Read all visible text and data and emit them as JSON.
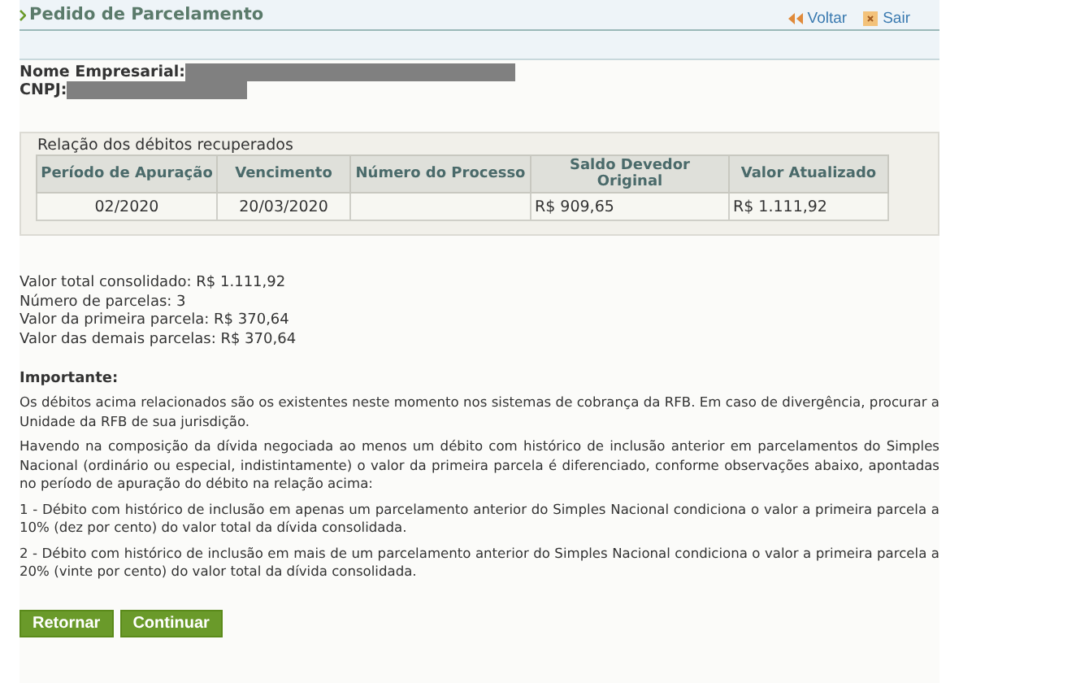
{
  "header": {
    "title": "Pedido de Parcelamento",
    "links": [
      {
        "kind": "back",
        "label": "Voltar"
      },
      {
        "kind": "exit",
        "label": "Sair"
      }
    ]
  },
  "company": {
    "name_label": "Nome Empresarial:",
    "cnpj_label": "CNPJ:"
  },
  "table": {
    "caption": "Relação dos débitos recuperados",
    "columns": [
      "Período de Apuração",
      "Vencimento",
      "Número do Processo",
      "Saldo Devedor Original",
      "Valor Atualizado"
    ],
    "rows": [
      [
        "02/2020",
        "20/03/2020",
        "",
        "R$ 909,65",
        "R$ 1.111,92"
      ]
    ]
  },
  "summary": [
    "Valor total consolidado: R$ 1.111,92",
    "Número de parcelas: 3",
    "Valor da primeira parcela: R$ 370,64",
    "Valor das demais parcelas: R$ 370,64"
  ],
  "notice": {
    "heading": "Importante:",
    "paragraphs": [
      "Os débitos acima relacionados são os existentes neste momento nos sistemas de cobrança da RFB. Em caso de divergência, procurar a Unidade da RFB de sua jurisdição.",
      "Havendo na composição da dívida negociada ao menos um débito com histórico de inclusão anterior em parcelamentos do Simples Nacional (ordinário ou especial, indistintamente) o valor da primeira parcela é diferenciado, conforme observações abaixo, apontadas no período de apuração do débito na relação acima:",
      "1 - Débito com histórico de inclusão em apenas um parcelamento anterior do Simples Nacional condiciona o valor a primeira parcela a 10% (dez por cento) do valor total da dívida consolidada.",
      "2 - Débito com histórico de inclusão em mais de um parcelamento anterior do Simples Nacional condiciona o valor a primeira parcela a 20% (vinte por cento) do valor total da dívida consolidada."
    ]
  },
  "buttons": [
    "Retornar",
    "Continuar"
  ]
}
